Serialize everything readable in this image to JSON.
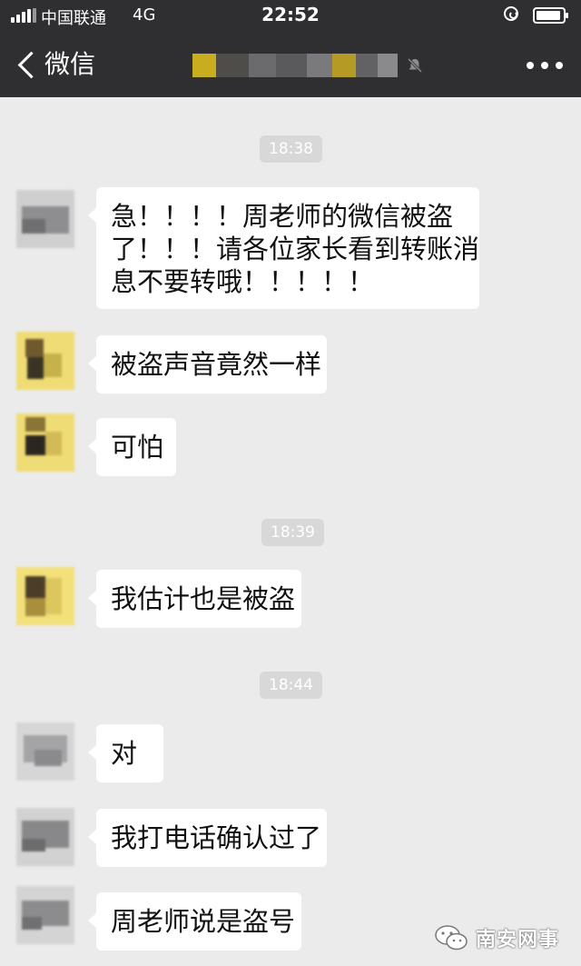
{
  "status_bar": {
    "carrier": "中国联通",
    "network": "4G",
    "time": "22:52"
  },
  "nav": {
    "back_label": "微信"
  },
  "messages": [
    {
      "type": "time",
      "text": "18:38"
    },
    {
      "type": "msg",
      "lines": [
        "急！！！！周老师的微信被盗",
        "了！！！请各位家长看到转账消",
        "息不要转哦！！！！！"
      ]
    },
    {
      "type": "msg",
      "lines": [
        "被盗声音竟然一样"
      ]
    },
    {
      "type": "msg",
      "lines": [
        "可怕"
      ]
    },
    {
      "type": "time",
      "text": "18:39"
    },
    {
      "type": "msg",
      "lines": [
        "我估计也是被盗"
      ]
    },
    {
      "type": "time",
      "text": "18:44"
    },
    {
      "type": "msg",
      "lines": [
        "对"
      ]
    },
    {
      "type": "msg",
      "lines": [
        "我打电话确认过了"
      ]
    },
    {
      "type": "msg",
      "lines": [
        "周老师说是盗号"
      ]
    }
  ],
  "watermark": {
    "text": "南安网事"
  },
  "colors": {
    "header_bg": "#2f2f31",
    "chat_bg": "#ebebeb",
    "bubble_bg": "#ffffff",
    "timestamp_bg": "#d8d8d8"
  }
}
